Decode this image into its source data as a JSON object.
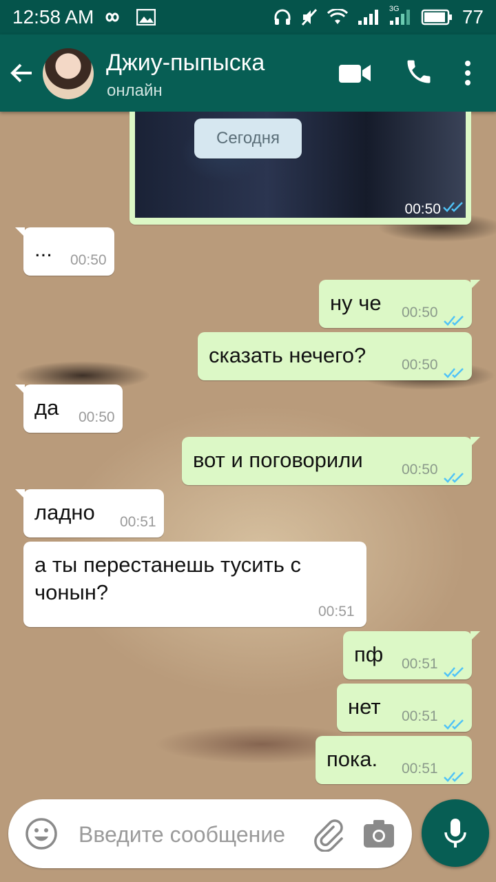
{
  "status_bar": {
    "time": "12:58 AM",
    "battery": "77",
    "network_label": "3G"
  },
  "header": {
    "contact_name": "Джиу-пыпыска",
    "status": "онлайн"
  },
  "date_chip": "Сегодня",
  "image_message": {
    "time": "00:50"
  },
  "messages": [
    {
      "dir": "in",
      "text": "...",
      "time": "00:50"
    },
    {
      "dir": "out",
      "text": "ну че",
      "time": "00:50"
    },
    {
      "dir": "out",
      "text": "сказать нечего?",
      "time": "00:50"
    },
    {
      "dir": "in",
      "text": "да",
      "time": "00:50"
    },
    {
      "dir": "out",
      "text": "вот и поговорили",
      "time": "00:50"
    },
    {
      "dir": "in",
      "text": "ладно",
      "time": "00:51"
    },
    {
      "dir": "in",
      "text_line1": "а ты перестанешь тусить с",
      "text_line2": "чонын?",
      "time": "00:51"
    },
    {
      "dir": "out",
      "text": "пф",
      "time": "00:51"
    },
    {
      "dir": "out",
      "text": "нет",
      "time": "00:51"
    },
    {
      "dir": "out",
      "text": "пока.",
      "time": "00:51"
    }
  ],
  "composer": {
    "placeholder": "Введите сообщение"
  },
  "colors": {
    "header": "#075e54",
    "status_bar": "#05544b",
    "outgoing_bubble": "#dcf8c6",
    "incoming_bubble": "#ffffff",
    "read_ticks": "#4fc3f7"
  },
  "icons": {
    "back": "arrow-left-icon",
    "video": "video-camera-icon",
    "call": "phone-icon",
    "more": "more-vertical-icon",
    "emoji": "smiley-icon",
    "attach": "paperclip-icon",
    "camera": "camera-icon",
    "mic": "microphone-icon"
  }
}
